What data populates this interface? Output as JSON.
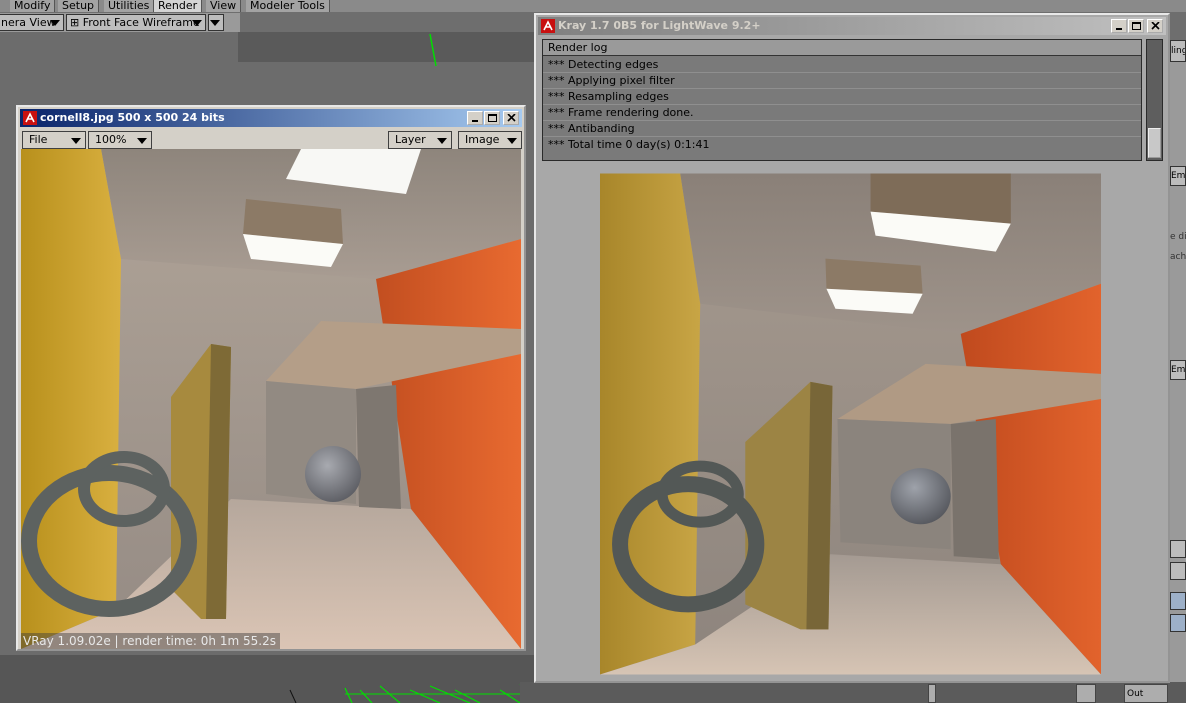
{
  "lightwave": {
    "tabs": [
      "Modify",
      "Setup",
      "Utilities",
      "Render",
      "View",
      "Modeler Tools"
    ],
    "active_tab": "Render",
    "view_mode": "nera View",
    "render_style": "Front Face Wireframe"
  },
  "image_viewer": {
    "title": "cornell8.jpg  500 x 500 24 bits",
    "menu_file": "File",
    "zoom": "100%",
    "menu_layer": "Layer",
    "menu_image": "Image",
    "caption": "VRay 1.09.02e | render time: 0h 1m 55.2s"
  },
  "kray_window": {
    "title": "Kray 1.7 0B5 for LightWave 9.2+",
    "log_header": "Render log",
    "log_lines": [
      "*** Detecting edges",
      "*** Applying pixel filter",
      "*** Resampling edges",
      "*** Frame rendering done.",
      "*** Antibanding",
      "*** Total time 0 day(s) 0:1:41"
    ]
  },
  "right_panel": {
    "label_top": "ling",
    "label_emi1": "Emi",
    "text_di": "e dis",
    "text_ach": "ach",
    "label_emi2": "Emi"
  },
  "bottom_bar": {
    "label_out": "Out"
  },
  "colors": {
    "title_active": "#0a246a",
    "title_inactive": "#808080",
    "wall_left": "#c39a28",
    "wall_right": "#d55a28",
    "wireframe": "#00e000"
  },
  "icons": [
    "lightwave-app-icon",
    "minimize-icon",
    "maximize-icon",
    "close-icon",
    "dropdown-arrow-icon"
  ]
}
